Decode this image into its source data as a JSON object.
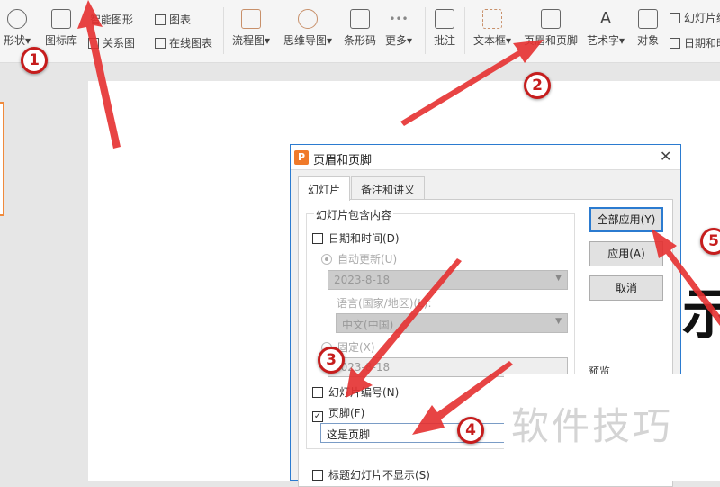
{
  "ribbon": {
    "shape": "形状",
    "icon_lib": "图标库",
    "smart_art": "智能图形",
    "chart": "图表",
    "relation": "关系图",
    "online_chart": "在线图表",
    "flowchart": "流程图",
    "mindmap": "思维导图",
    "barcode": "条形码",
    "more": "更多",
    "comment": "批注",
    "textbox": "文本框",
    "header_footer": "页眉和页脚",
    "wordart": "艺术字",
    "object": "对象",
    "slide_number": "幻灯片编",
    "date_time": "日期和时"
  },
  "dialog": {
    "title": "页眉和页脚",
    "close": "✕",
    "tabs": [
      "幻灯片",
      "备注和讲义"
    ],
    "group_label": "幻灯片包含内容",
    "date_time_label": "日期和时间(D)",
    "auto_update_label": "自动更新(U)",
    "auto_date": "2023-8-18",
    "language_label": "语言(国家/地区)(L):",
    "language": "中文(中国)",
    "fixed_label": "固定(X)",
    "fixed_value": "2023-8-18",
    "slide_number_label": "幻灯片编号(N)",
    "footer_label": "页脚(F)",
    "footer_checked": true,
    "footer_value": "这是页脚",
    "hide_on_title_label": "标题幻灯片不显示(S)",
    "apply_all": "全部应用(Y)",
    "apply": "应用(A)",
    "cancel": "取消",
    "preview_label": "预览"
  },
  "annotations": [
    "1",
    "2",
    "3",
    "4",
    "5"
  ],
  "watermark": "软件技巧",
  "colors": {
    "accent": "#2b7bd0",
    "arrow": "#e53030",
    "thumb_border": "#f08a3c"
  }
}
